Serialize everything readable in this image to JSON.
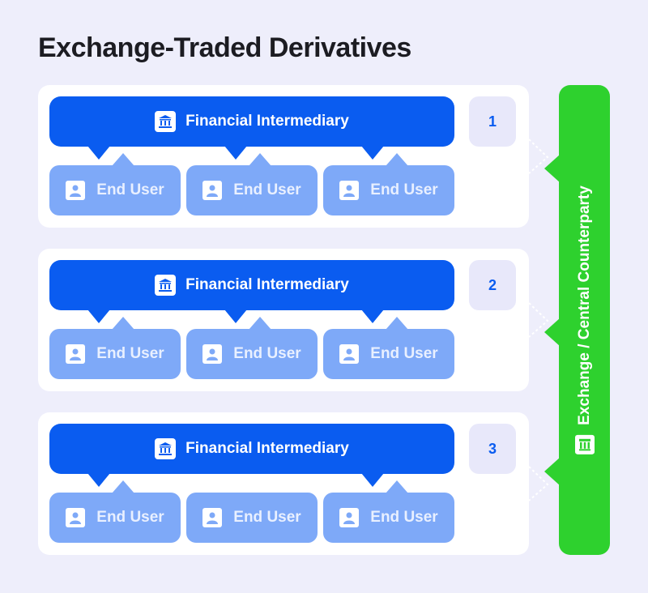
{
  "title": "Exchange-Traded Derivatives",
  "groups": [
    {
      "number": "1",
      "intermediary": "Financial Intermediary",
      "end_users": [
        "End User",
        "End User",
        "End User"
      ],
      "links": [
        0,
        1,
        2
      ]
    },
    {
      "number": "2",
      "intermediary": "Financial Intermediary",
      "end_users": [
        "End User",
        "End User",
        "End User"
      ],
      "links": [
        0,
        1,
        2
      ]
    },
    {
      "number": "3",
      "intermediary": "Financial Intermediary",
      "end_users": [
        "End User",
        "End User",
        "End User"
      ],
      "links": [
        0,
        2
      ]
    }
  ],
  "counterparty": {
    "label": "Exchange / Central Counterparty",
    "icon": "exchange-building-icon"
  },
  "icons": {
    "intermediary": "bank-icon",
    "end_user": "user-icon"
  },
  "colors": {
    "background": "#eeeefb",
    "intermediary": "#0a5cf0",
    "end_user": "#7ea9f8",
    "counterparty": "#2ed12e",
    "number_box": "#e8e8fa"
  }
}
